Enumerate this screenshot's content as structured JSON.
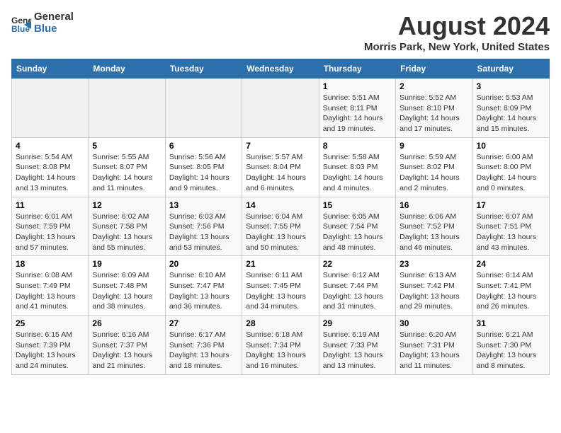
{
  "header": {
    "logo_line1": "General",
    "logo_line2": "Blue",
    "month_year": "August 2024",
    "location": "Morris Park, New York, United States"
  },
  "days_of_week": [
    "Sunday",
    "Monday",
    "Tuesday",
    "Wednesday",
    "Thursday",
    "Friday",
    "Saturday"
  ],
  "weeks": [
    [
      {
        "day": "",
        "info": ""
      },
      {
        "day": "",
        "info": ""
      },
      {
        "day": "",
        "info": ""
      },
      {
        "day": "",
        "info": ""
      },
      {
        "day": "1",
        "info": "Sunrise: 5:51 AM\nSunset: 8:11 PM\nDaylight: 14 hours\nand 19 minutes."
      },
      {
        "day": "2",
        "info": "Sunrise: 5:52 AM\nSunset: 8:10 PM\nDaylight: 14 hours\nand 17 minutes."
      },
      {
        "day": "3",
        "info": "Sunrise: 5:53 AM\nSunset: 8:09 PM\nDaylight: 14 hours\nand 15 minutes."
      }
    ],
    [
      {
        "day": "4",
        "info": "Sunrise: 5:54 AM\nSunset: 8:08 PM\nDaylight: 14 hours\nand 13 minutes."
      },
      {
        "day": "5",
        "info": "Sunrise: 5:55 AM\nSunset: 8:07 PM\nDaylight: 14 hours\nand 11 minutes."
      },
      {
        "day": "6",
        "info": "Sunrise: 5:56 AM\nSunset: 8:05 PM\nDaylight: 14 hours\nand 9 minutes."
      },
      {
        "day": "7",
        "info": "Sunrise: 5:57 AM\nSunset: 8:04 PM\nDaylight: 14 hours\nand 6 minutes."
      },
      {
        "day": "8",
        "info": "Sunrise: 5:58 AM\nSunset: 8:03 PM\nDaylight: 14 hours\nand 4 minutes."
      },
      {
        "day": "9",
        "info": "Sunrise: 5:59 AM\nSunset: 8:02 PM\nDaylight: 14 hours\nand 2 minutes."
      },
      {
        "day": "10",
        "info": "Sunrise: 6:00 AM\nSunset: 8:00 PM\nDaylight: 14 hours\nand 0 minutes."
      }
    ],
    [
      {
        "day": "11",
        "info": "Sunrise: 6:01 AM\nSunset: 7:59 PM\nDaylight: 13 hours\nand 57 minutes."
      },
      {
        "day": "12",
        "info": "Sunrise: 6:02 AM\nSunset: 7:58 PM\nDaylight: 13 hours\nand 55 minutes."
      },
      {
        "day": "13",
        "info": "Sunrise: 6:03 AM\nSunset: 7:56 PM\nDaylight: 13 hours\nand 53 minutes."
      },
      {
        "day": "14",
        "info": "Sunrise: 6:04 AM\nSunset: 7:55 PM\nDaylight: 13 hours\nand 50 minutes."
      },
      {
        "day": "15",
        "info": "Sunrise: 6:05 AM\nSunset: 7:54 PM\nDaylight: 13 hours\nand 48 minutes."
      },
      {
        "day": "16",
        "info": "Sunrise: 6:06 AM\nSunset: 7:52 PM\nDaylight: 13 hours\nand 46 minutes."
      },
      {
        "day": "17",
        "info": "Sunrise: 6:07 AM\nSunset: 7:51 PM\nDaylight: 13 hours\nand 43 minutes."
      }
    ],
    [
      {
        "day": "18",
        "info": "Sunrise: 6:08 AM\nSunset: 7:49 PM\nDaylight: 13 hours\nand 41 minutes."
      },
      {
        "day": "19",
        "info": "Sunrise: 6:09 AM\nSunset: 7:48 PM\nDaylight: 13 hours\nand 38 minutes."
      },
      {
        "day": "20",
        "info": "Sunrise: 6:10 AM\nSunset: 7:47 PM\nDaylight: 13 hours\nand 36 minutes."
      },
      {
        "day": "21",
        "info": "Sunrise: 6:11 AM\nSunset: 7:45 PM\nDaylight: 13 hours\nand 34 minutes."
      },
      {
        "day": "22",
        "info": "Sunrise: 6:12 AM\nSunset: 7:44 PM\nDaylight: 13 hours\nand 31 minutes."
      },
      {
        "day": "23",
        "info": "Sunrise: 6:13 AM\nSunset: 7:42 PM\nDaylight: 13 hours\nand 29 minutes."
      },
      {
        "day": "24",
        "info": "Sunrise: 6:14 AM\nSunset: 7:41 PM\nDaylight: 13 hours\nand 26 minutes."
      }
    ],
    [
      {
        "day": "25",
        "info": "Sunrise: 6:15 AM\nSunset: 7:39 PM\nDaylight: 13 hours\nand 24 minutes."
      },
      {
        "day": "26",
        "info": "Sunrise: 6:16 AM\nSunset: 7:37 PM\nDaylight: 13 hours\nand 21 minutes."
      },
      {
        "day": "27",
        "info": "Sunrise: 6:17 AM\nSunset: 7:36 PM\nDaylight: 13 hours\nand 18 minutes."
      },
      {
        "day": "28",
        "info": "Sunrise: 6:18 AM\nSunset: 7:34 PM\nDaylight: 13 hours\nand 16 minutes."
      },
      {
        "day": "29",
        "info": "Sunrise: 6:19 AM\nSunset: 7:33 PM\nDaylight: 13 hours\nand 13 minutes."
      },
      {
        "day": "30",
        "info": "Sunrise: 6:20 AM\nSunset: 7:31 PM\nDaylight: 13 hours\nand 11 minutes."
      },
      {
        "day": "31",
        "info": "Sunrise: 6:21 AM\nSunset: 7:30 PM\nDaylight: 13 hours\nand 8 minutes."
      }
    ]
  ]
}
